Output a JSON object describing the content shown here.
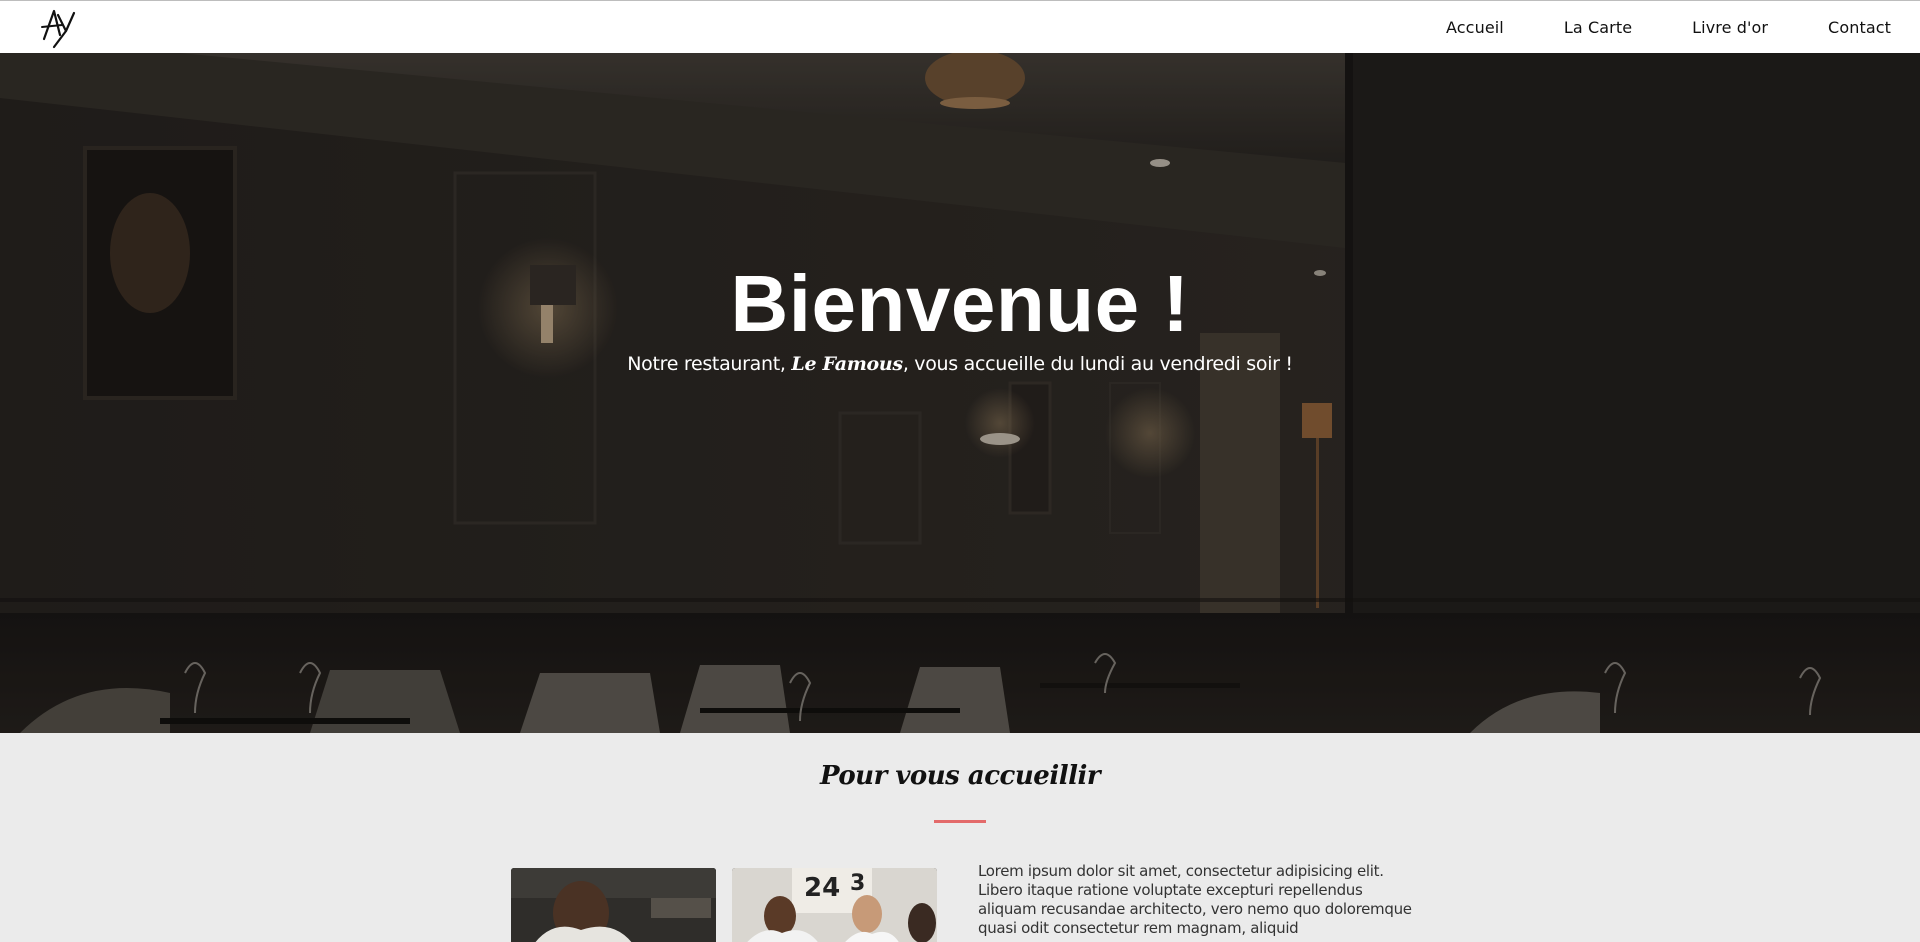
{
  "nav": {
    "logo_icon": "signature-logo",
    "items": [
      {
        "label": "Accueil"
      },
      {
        "label": "La Carte"
      },
      {
        "label": "Livre d'or"
      },
      {
        "label": "Contact"
      }
    ]
  },
  "hero": {
    "title": "Bienvenue !",
    "subtitle_before": "Notre restaurant, ",
    "subtitle_brand": "Le Famous",
    "subtitle_after": ", vous accueille du lundi au vendredi soir !",
    "background_image": "restaurant-dining-room-photo"
  },
  "welcome": {
    "title": "Pour vous accueillir",
    "divider_color": "#e36a6a",
    "photos": [
      "chef-photo",
      "staff-photo"
    ],
    "text": "Lorem ipsum dolor sit amet, consectetur adipisicing elit. Libero itaque ratione voluptate excepturi repellendus aliquam recusandae architecto, vero nemo quo doloremque quasi odit consectetur rem magnam, aliquid"
  },
  "colors": {
    "accent": "#e36a6a",
    "section_bg": "#ebebeb",
    "nav_bg": "#ffffff"
  }
}
